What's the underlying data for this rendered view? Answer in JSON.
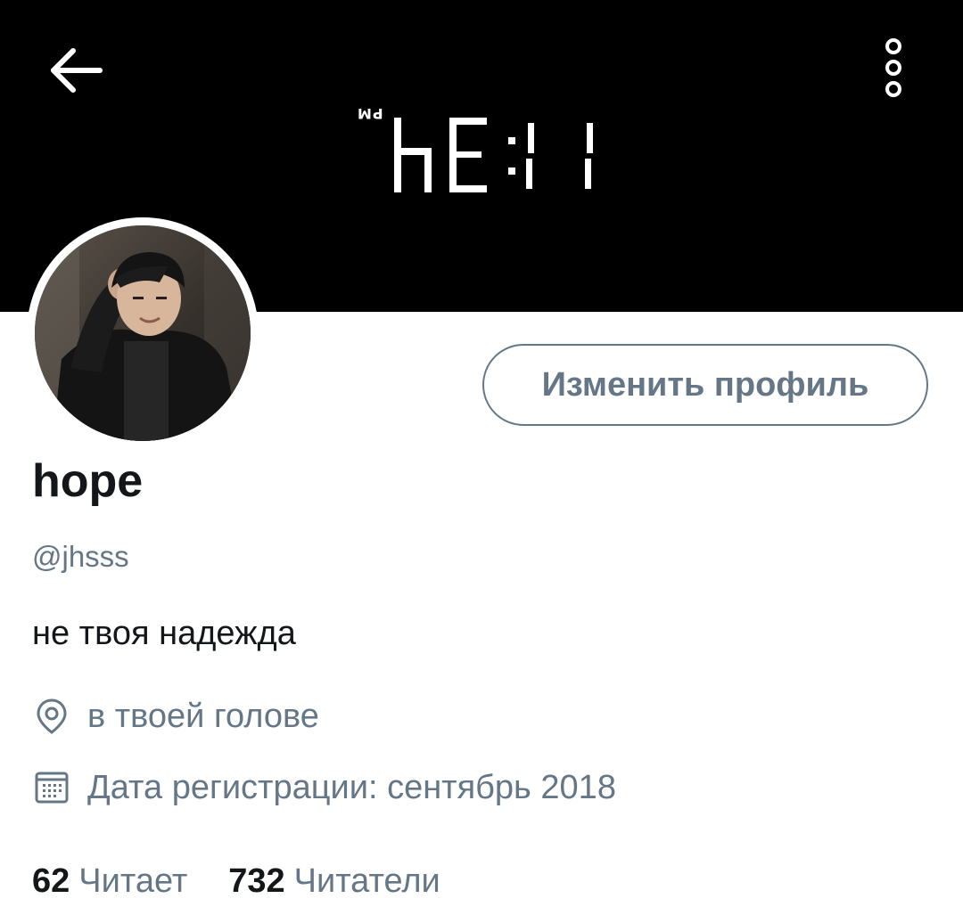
{
  "header": {
    "back_icon": "arrow-left-icon",
    "more_icon": "more-vertical-icon",
    "banner_clock": {
      "time": "11:3h",
      "ampm": "PM"
    }
  },
  "profile": {
    "avatar_icon": "avatar",
    "edit_button_label": "Изменить профиль",
    "display_name": "hope",
    "handle": "@jhsss",
    "bio": "не твоя надежда",
    "location": "в твоей голове",
    "location_icon": "location-pin-icon",
    "join_date": "Дата регистрации: сентябрь 2018",
    "join_date_icon": "calendar-icon"
  },
  "stats": {
    "following_count": "62",
    "following_label": "Читает",
    "followers_count": "732",
    "followers_label": "Читатели"
  },
  "colors": {
    "banner": "#000000",
    "text_primary": "#14171a",
    "text_secondary": "#657786"
  }
}
